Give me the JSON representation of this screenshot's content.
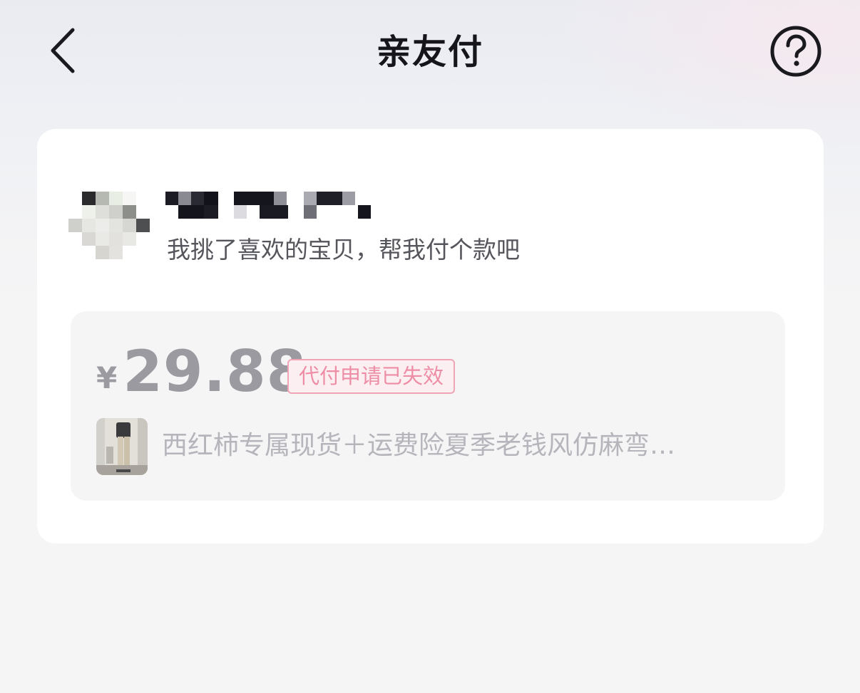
{
  "header": {
    "title": "亲友付",
    "back_icon": "chevron-left-icon",
    "help_icon": "question-circle-icon"
  },
  "request": {
    "message": "我挑了喜欢的宝贝，帮我付个款吧",
    "price": {
      "currency": "¥",
      "amount": "29.88"
    },
    "status": "代付申请已失效",
    "product": {
      "title": "西红柿专属现货＋运费险夏季老钱风仿麻弯…"
    }
  },
  "colors": {
    "badge_border": "#f0a4b6",
    "badge_text": "#ee8ea6",
    "muted_text": "#9b9aa1"
  }
}
